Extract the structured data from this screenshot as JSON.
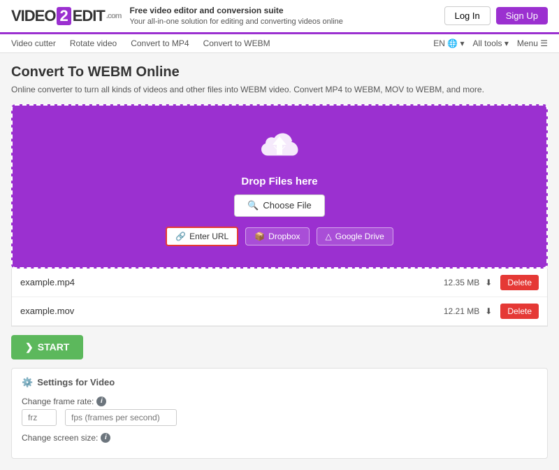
{
  "header": {
    "logo_text1": "VIDEO",
    "logo_2": "2",
    "logo_text2": "EDIT",
    "logo_suffix": ".com",
    "tagline_bold": "Free video editor and conversion suite",
    "tagline_sub": "Your all-in-one solution for editing and converting videos online",
    "btn_login": "Log In",
    "btn_signup": "Sign Up"
  },
  "nav": {
    "links": [
      {
        "label": "Video cutter"
      },
      {
        "label": "Rotate video"
      },
      {
        "label": "Convert to MP4"
      },
      {
        "label": "Convert to WEBM"
      }
    ],
    "right": [
      {
        "label": "EN 🌐 ▾"
      },
      {
        "label": "All tools ▾"
      },
      {
        "label": "Menu ☰"
      }
    ]
  },
  "page": {
    "title": "Convert To WEBM Online",
    "description": "Online converter to turn all kinds of videos and other files into WEBM video. Convert MP4 to WEBM, MOV to WEBM, and more."
  },
  "upload": {
    "drop_text": "Drop Files here",
    "choose_file": "Choose File",
    "enter_url": "Enter URL",
    "dropbox": "Dropbox",
    "gdrive": "Google Drive"
  },
  "files": [
    {
      "name": "example.mp4",
      "size": "12.35 MB"
    },
    {
      "name": "example.mov",
      "size": "12.21 MB"
    }
  ],
  "actions": {
    "start": "START",
    "delete": "Delete"
  },
  "settings": {
    "title": "Settings for Video",
    "frame_rate_label": "Change frame rate:",
    "frame_rate_placeholder": "frz",
    "frame_rate_unit": "fps (frames per second)",
    "screen_size_label": "Change screen size:"
  }
}
